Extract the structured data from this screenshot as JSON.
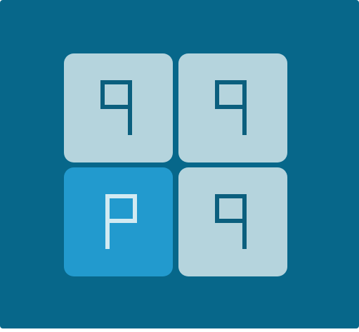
{
  "game": {
    "tiles": [
      {
        "glyph": "q-glyph",
        "odd": false,
        "color": "#0b5f7e"
      },
      {
        "glyph": "q-glyph",
        "odd": false,
        "color": "#0b5f7e"
      },
      {
        "glyph": "p-glyph",
        "odd": true,
        "color": "#d2eaf2"
      },
      {
        "glyph": "q-glyph",
        "odd": false,
        "color": "#0b5f7e"
      }
    ]
  },
  "colors": {
    "background": "#07678a",
    "tile": "#b5d4dd",
    "odd_tile": "#229ace",
    "glyph_dark": "#0b5f7e",
    "glyph_light": "#d2eaf2"
  }
}
